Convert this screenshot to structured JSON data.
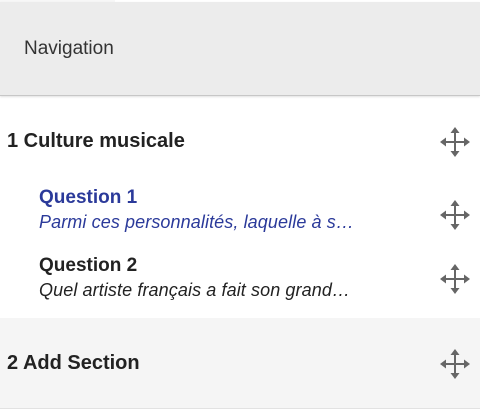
{
  "navigation": {
    "title": "Navigation"
  },
  "sections": [
    {
      "title": "1 Culture musicale",
      "questions": [
        {
          "title": "Question 1",
          "text": "Parmi ces personnalités, laquelle à s…",
          "active": true
        },
        {
          "title": "Question 2",
          "text": "Quel artiste français a fait son grand…",
          "active": false
        }
      ]
    },
    {
      "title": "2 Add Section",
      "questions": []
    }
  ],
  "colors": {
    "header_bg": "#ececec",
    "active_question": "#2b3a9a",
    "section_alt_bg": "#f5f5f5",
    "icon": "#666666"
  },
  "icons": {
    "drag": "move-arrows-icon"
  }
}
